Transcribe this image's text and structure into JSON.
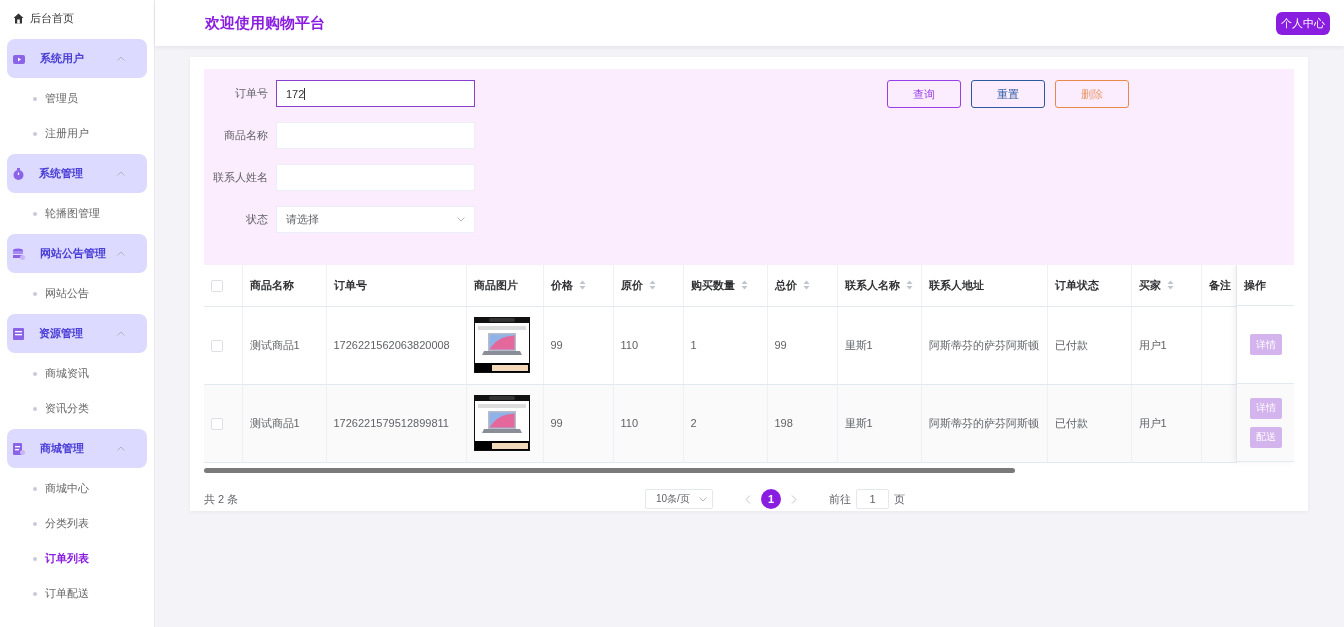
{
  "sidebar": {
    "home": {
      "label": "后台首页"
    },
    "groups": [
      {
        "label": "系统用户",
        "expanded": true,
        "items": [
          {
            "label": "管理员",
            "selected": false
          },
          {
            "label": "注册用户",
            "selected": false
          }
        ]
      },
      {
        "label": "系统管理",
        "expanded": true,
        "items": [
          {
            "label": "轮播图管理",
            "selected": false
          }
        ]
      },
      {
        "label": "网站公告管理",
        "expanded": true,
        "items": [
          {
            "label": "网站公告",
            "selected": false
          }
        ]
      },
      {
        "label": "资源管理",
        "expanded": true,
        "items": [
          {
            "label": "商城资讯",
            "selected": false
          },
          {
            "label": "资讯分类",
            "selected": false
          }
        ]
      },
      {
        "label": "商城管理",
        "expanded": true,
        "items": [
          {
            "label": "商城中心",
            "selected": false
          },
          {
            "label": "分类列表",
            "selected": false
          },
          {
            "label": "订单列表",
            "selected": true
          },
          {
            "label": "订单配送",
            "selected": false
          }
        ]
      }
    ]
  },
  "header": {
    "title": "欢迎使用购物平台",
    "user_button": "个人中心"
  },
  "search": {
    "fields": [
      {
        "kind": "text",
        "label": "订单号",
        "value": "172",
        "focused": true
      },
      {
        "kind": "text",
        "label": "商品名称",
        "focused": false
      },
      {
        "kind": "text",
        "label": "联系人姓名",
        "focused": false
      },
      {
        "kind": "select",
        "label": "状态",
        "placeholder": "请选择",
        "focused": false
      }
    ],
    "buttons": [
      {
        "kind": "query",
        "label": "查询"
      },
      {
        "kind": "reset",
        "label": "重置"
      },
      {
        "kind": "delete",
        "label": "删除"
      }
    ]
  },
  "table": {
    "header_checked": false,
    "columns": [
      {
        "label": "商品名称",
        "sortable": false
      },
      {
        "label": "订单号",
        "sortable": false
      },
      {
        "label": "商品图片",
        "sortable": false
      },
      {
        "label": "价格",
        "sortable": true
      },
      {
        "label": "原价",
        "sortable": true
      },
      {
        "label": "购买数量",
        "sortable": true
      },
      {
        "label": "总价",
        "sortable": true
      },
      {
        "label": "联系人名称",
        "sortable": true
      },
      {
        "label": "联系人地址",
        "sortable": false
      },
      {
        "label": "订单状态",
        "sortable": false
      },
      {
        "label": "买家",
        "sortable": true
      },
      {
        "label": "备注"
      }
    ],
    "action_column": "操作",
    "rows": [
      {
        "checked": false,
        "cells": [
          "测试商品1",
          "1726221562063820008",
          {
            "kind": "picture"
          },
          "99",
          "110",
          "1",
          "99",
          "里斯1",
          "阿斯蒂芬的萨芬阿斯顿",
          "已付款",
          "用户1",
          ""
        ],
        "actions": [
          "详情"
        ]
      },
      {
        "checked": false,
        "cells": [
          "测试商品1",
          "1726221579512899811",
          {
            "kind": "picture"
          },
          "99",
          "110",
          "2",
          "198",
          "里斯1",
          "阿斯蒂芬的萨芬阿斯顿",
          "已付款",
          "用户1",
          ""
        ],
        "actions": [
          "详情",
          "配送"
        ]
      }
    ]
  },
  "pagination": {
    "total": "共 2 条",
    "page_size": "10条/页",
    "pages": [
      {
        "label": "1",
        "selected": true
      }
    ],
    "goto_label": "前往",
    "goto_value": "1",
    "goto_suffix": "页"
  }
}
